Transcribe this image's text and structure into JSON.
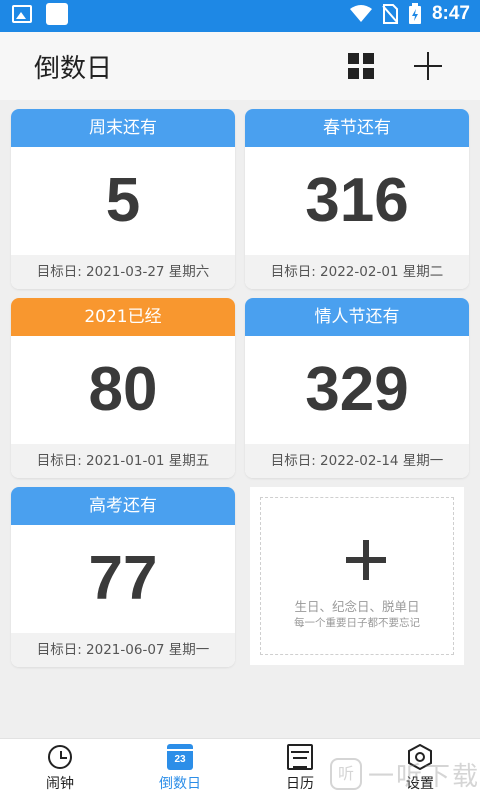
{
  "status_bar": {
    "time": "8:47"
  },
  "header": {
    "title": "倒数日"
  },
  "cards": [
    {
      "title": "周末还有",
      "days": "5",
      "target": "目标日: 2021-03-27 星期六",
      "color": "#4aa0ef"
    },
    {
      "title": "春节还有",
      "days": "316",
      "target": "目标日: 2022-02-01 星期二",
      "color": "#4aa0ef"
    },
    {
      "title": "2021已经",
      "days": "80",
      "target": "目标日: 2021-01-01 星期五",
      "color": "#f8972f"
    },
    {
      "title": "情人节还有",
      "days": "329",
      "target": "目标日: 2022-02-14 星期一",
      "color": "#4aa0ef"
    },
    {
      "title": "高考还有",
      "days": "77",
      "target": "目标日: 2021-06-07 星期一",
      "color": "#4aa0ef"
    }
  ],
  "add_card": {
    "line1": "生日、纪念日、脱单日",
    "line2": "每一个重要日子都不要忘记"
  },
  "bottom_nav": [
    {
      "label": "闹钟",
      "icon": "alarm-clock-icon"
    },
    {
      "label": "倒数日",
      "icon": "calendar-countdown-icon",
      "icon_text": "23",
      "active": true
    },
    {
      "label": "日历",
      "icon": "calendar-icon"
    },
    {
      "label": "设置",
      "icon": "settings-icon"
    }
  ],
  "watermark": {
    "logo": "听",
    "text": "一听下载"
  },
  "colors": {
    "status_bar": "#1e88e5",
    "accent_blue": "#4aa0ef",
    "accent_orange": "#f8972f",
    "active_tab": "#2c8ee8"
  }
}
